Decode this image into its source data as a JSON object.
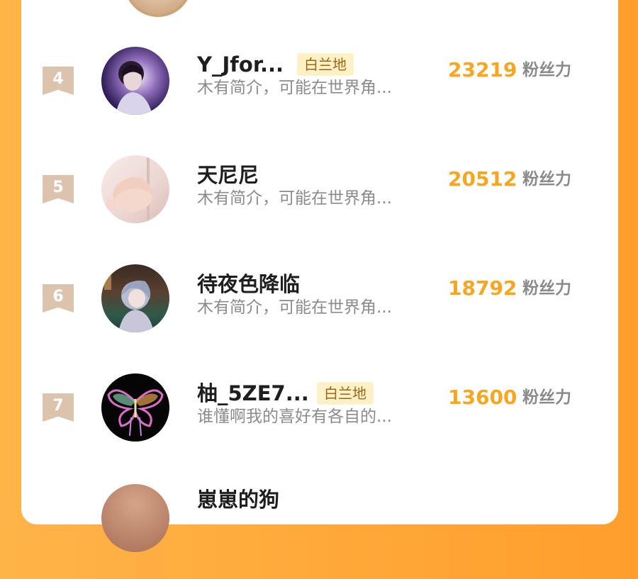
{
  "colors": {
    "background": "#ffa63a",
    "score": "#f5a623",
    "rank_tag": "#dcc3ae",
    "badge_bg": "#fff1c7",
    "badge_text": "#9a6612"
  },
  "rows": [
    {
      "rank": "4",
      "name": "Y_Jfor...",
      "badge": "白兰地",
      "bio": "木有简介，可能在世界角...",
      "score": "23219",
      "unit": "粉丝力",
      "avatar": "person-portrait"
    },
    {
      "rank": "5",
      "name": "天尼尼",
      "badge": "",
      "bio": "木有简介，可能在世界角...",
      "score": "20512",
      "unit": "粉丝力",
      "avatar": "anime-character"
    },
    {
      "rank": "6",
      "name": "待夜色降临",
      "badge": "",
      "bio": "木有简介，可能在世界角...",
      "score": "18792",
      "unit": "粉丝力",
      "avatar": "anime-character"
    },
    {
      "rank": "7",
      "name": "柚_5ZE7...",
      "badge": "白兰地",
      "bio": "谁懂啊我的喜好有各自的...",
      "score": "13600",
      "unit": "粉丝力",
      "avatar": "butterfly"
    }
  ],
  "partial_next_name": "崽崽的狗"
}
